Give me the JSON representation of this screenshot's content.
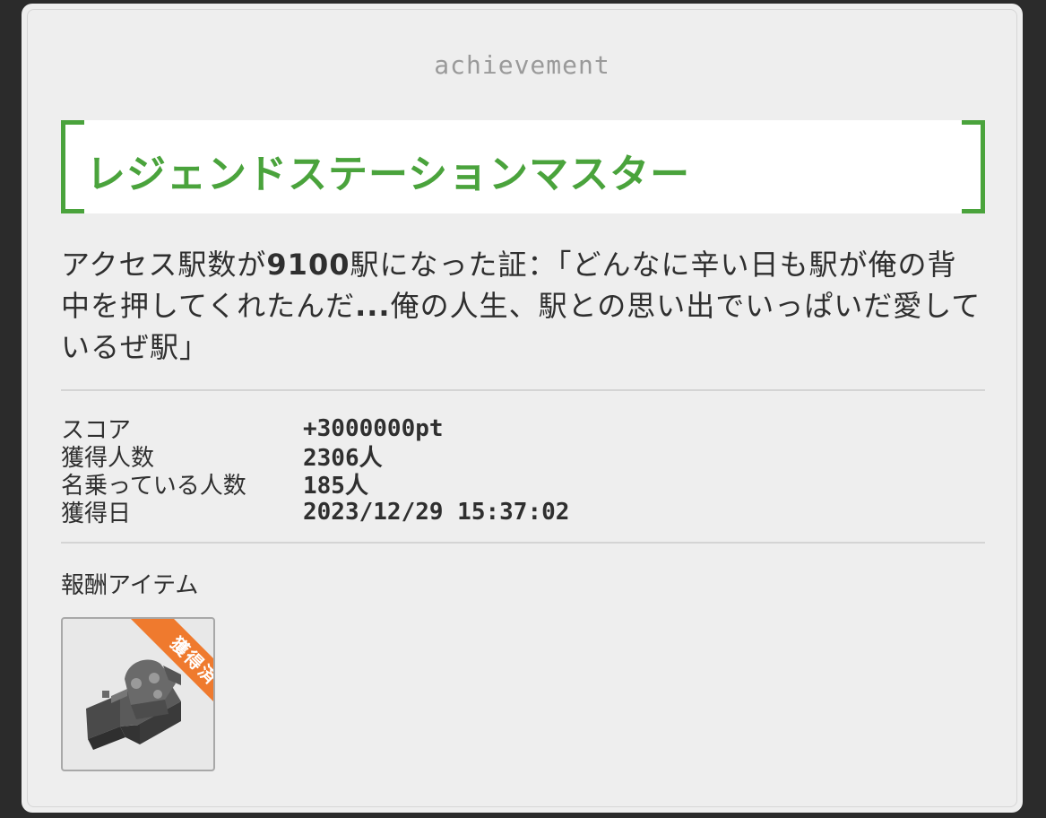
{
  "header": {
    "title": "achievement"
  },
  "achievement": {
    "name": "レジェンドステーションマスター",
    "description_prefix": "アクセス駅数が",
    "description_number": "9100",
    "description_suffix": "駅になった証：「どんなに辛い日も駅が俺の背中を押してくれたんだ",
    "description_ellipsis": "...",
    "description_rest": "俺の人生、駅との思い出でいっぱいだ愛しているぜ駅」"
  },
  "stats": [
    {
      "label": "スコア",
      "value": "+3000000pt"
    },
    {
      "label": "獲得人数",
      "value": "2306人"
    },
    {
      "label": "名乗っている人数",
      "value": "185人"
    },
    {
      "label": "獲得日",
      "value": "2023/12/29 15:37:02"
    }
  ],
  "reward": {
    "title": "報酬アイテム",
    "item_badge": "獲得済",
    "item_icon": "mechanical-part-icon"
  },
  "colors": {
    "accent_green": "#4aa33c",
    "badge_orange": "#ef7a2e",
    "panel_bg": "#eeeeee"
  }
}
